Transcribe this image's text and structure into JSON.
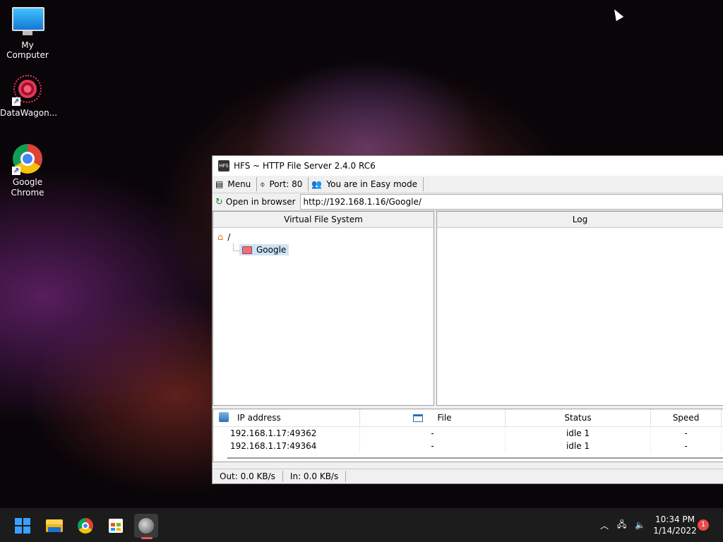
{
  "desktop": {
    "icons": [
      {
        "label": "My Computer"
      },
      {
        "label": "DataWagon..."
      },
      {
        "label": "Google\nChrome"
      }
    ]
  },
  "window": {
    "title": "HFS ~ HTTP File Server 2.4.0 RC6",
    "toolbar": {
      "menu": "Menu",
      "port": "Port: 80",
      "mode": "You are in Easy mode"
    },
    "open_in_browser": "Open in browser",
    "url": "http://192.168.1.16/Google/",
    "vfs_header": "Virtual File System",
    "log_header": "Log",
    "tree": {
      "root": "/",
      "child": "Google"
    },
    "connections": {
      "headers": [
        "IP address",
        "File",
        "Status",
        "Speed"
      ],
      "rows": [
        {
          "ip": "192.168.1.17:49362",
          "file": "-",
          "status": "idle 1",
          "speed": "-"
        },
        {
          "ip": "192.168.1.17:49364",
          "file": "-",
          "status": "idle 1",
          "speed": "-"
        }
      ]
    },
    "status": {
      "out": "Out: 0.0 KB/s",
      "in": "In: 0.0 KB/s"
    }
  },
  "taskbar": {
    "time": "10:34 PM",
    "date": "1/14/2022",
    "notification_count": "1"
  }
}
